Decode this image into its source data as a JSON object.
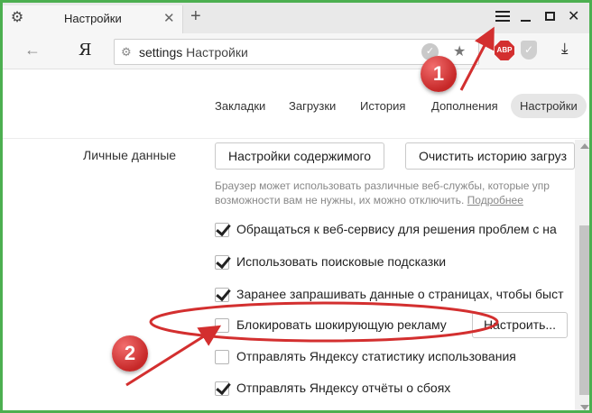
{
  "browser": {
    "tab_title": "Настройки",
    "address_prefix": "settings",
    "address_title": "Настройки",
    "logo": "Я",
    "abp_label": "ABP"
  },
  "nav": {
    "items": [
      "Закладки",
      "Загрузки",
      "История",
      "Дополнения",
      "Настройки"
    ],
    "active": "Настройки"
  },
  "section": {
    "label": "Личные данные",
    "buttons": [
      "Настройки содержимого",
      "Очистить историю загруз"
    ],
    "description_line1": "Браузер может использовать различные веб-службы, которые упр",
    "description_line2": "возможности вам не нужны, их можно отключить.",
    "description_link": "Подробнее"
  },
  "options": [
    {
      "label": "Обращаться к веб-сервису для решения проблем с на",
      "checked": true
    },
    {
      "label": "Использовать поисковые подсказки",
      "checked": true
    },
    {
      "label": "Заранее запрашивать данные о страницах, чтобы быст",
      "checked": true
    },
    {
      "label": "Блокировать шокирующую рекламу",
      "checked": false
    },
    {
      "label": "Отправлять Яндексу статистику использования",
      "checked": false
    },
    {
      "label": "Отправлять Яндексу отчёты о сбоях",
      "checked": true
    }
  ],
  "configure_button": "Настроить...",
  "annotations": {
    "badge1": "1",
    "badge2": "2",
    "color": "#d32f2f"
  },
  "icons": {
    "tab": "gear-icon",
    "menu": "hamburger-menu-icon",
    "back": "back-arrow-icon",
    "bookmark": "star-icon",
    "download": "download-icon"
  },
  "colors": {
    "frame_border": "#4caf50",
    "annotation": "#d32f2f"
  }
}
